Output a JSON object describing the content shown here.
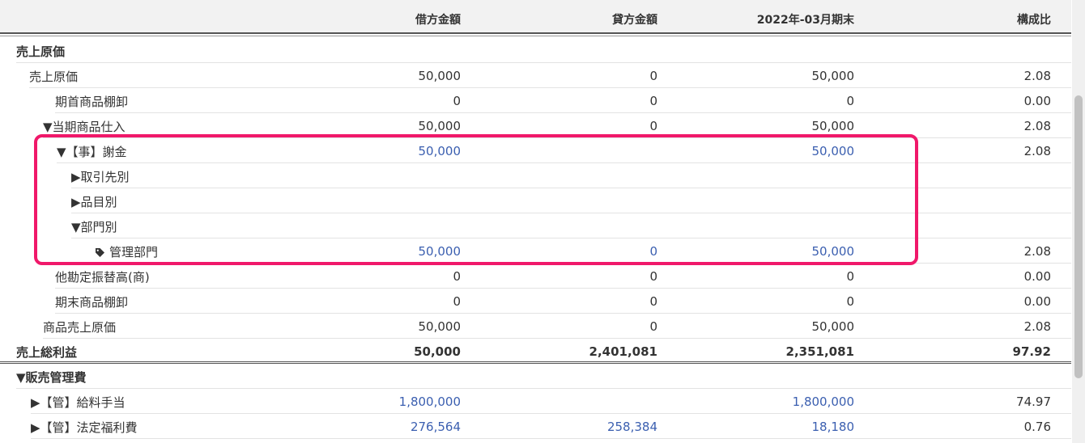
{
  "header": {
    "debit": "借方金額",
    "credit": "貸方金額",
    "period": "2022年-03月期末",
    "ratio": "構成比"
  },
  "rows": [
    {
      "label": "売上原価",
      "indent": 20,
      "bold": true,
      "values": [
        "",
        "",
        "",
        ""
      ],
      "link": false
    },
    {
      "label": "売上原価",
      "indent": 36,
      "values": [
        "50,000",
        "0",
        "50,000",
        "2.08"
      ],
      "link": false
    },
    {
      "label": "期首商品棚卸",
      "indent": 68,
      "values": [
        "0",
        "0",
        "0",
        "0.00"
      ],
      "link": false
    },
    {
      "label": "▼当期商品仕入",
      "indent": 53,
      "values": [
        "50,000",
        "0",
        "50,000",
        "2.08"
      ],
      "link": false
    },
    {
      "label": "▼【事】謝金",
      "indent": 70,
      "values": [
        "50,000",
        "",
        "50,000",
        "2.08"
      ],
      "link": true
    },
    {
      "label": "▶取引先別",
      "indent": 88,
      "values": [
        "",
        "",
        "",
        ""
      ],
      "link": false
    },
    {
      "label": "▶品目別",
      "indent": 88,
      "values": [
        "",
        "",
        "",
        ""
      ],
      "link": false
    },
    {
      "label": "▼部門別",
      "indent": 88,
      "values": [
        "",
        "",
        "",
        ""
      ],
      "link": false
    },
    {
      "label": "管理部門",
      "indent": 118,
      "tag": true,
      "values": [
        "50,000",
        "0",
        "50,000",
        "2.08"
      ],
      "link": true
    },
    {
      "label": "他勘定振替高(商)",
      "indent": 68,
      "values": [
        "0",
        "0",
        "0",
        "0.00"
      ],
      "link": false
    },
    {
      "label": "期末商品棚卸",
      "indent": 68,
      "values": [
        "0",
        "0",
        "0",
        "0.00"
      ],
      "link": false
    },
    {
      "label": "商品売上原価",
      "indent": 53,
      "values": [
        "50,000",
        "0",
        "50,000",
        "2.08"
      ],
      "link": false
    },
    {
      "label": "売上総利益",
      "indent": 20,
      "bold": true,
      "total": true,
      "values": [
        "50,000",
        "2,401,081",
        "2,351,081",
        "97.92"
      ],
      "link": false
    },
    {
      "label": "▼販売管理費",
      "indent": 20,
      "bold": true,
      "values": [
        "",
        "",
        "",
        ""
      ],
      "link": false
    },
    {
      "label": "▶【管】給料手当",
      "indent": 38,
      "values": [
        "1,800,000",
        "",
        "1,800,000",
        "74.97"
      ],
      "link": true
    },
    {
      "label": "▶【管】法定福利費",
      "indent": 38,
      "values": [
        "276,564",
        "258,384",
        "18,180",
        "0.76"
      ],
      "link": true
    }
  ]
}
